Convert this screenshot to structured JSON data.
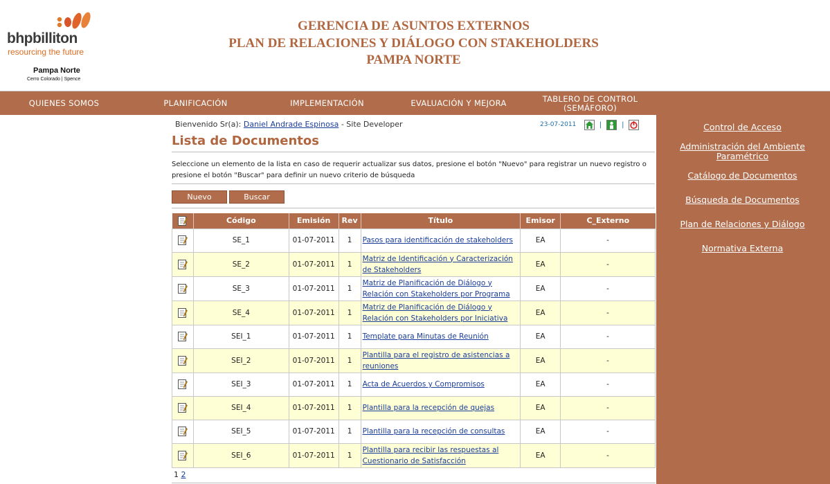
{
  "logo": {
    "brand": "bhpbilliton",
    "tagline": "resourcing the future",
    "site": "Pampa Norte",
    "sub": "Cerro Colorado | Spence"
  },
  "header": {
    "line1": "GERENCIA DE ASUNTOS EXTERNOS",
    "line2": "PLAN DE RELACIONES Y DIÁLOGO CON STAKEHOLDERS",
    "line3": "PAMPA NORTE"
  },
  "nav": {
    "items": [
      {
        "label": "QUIENES SOMOS"
      },
      {
        "label": "PLANIFICACIÓN"
      },
      {
        "label": "IMPLEMENTACIÓN"
      },
      {
        "label": "EVALUACIÓN Y MEJORA"
      },
      {
        "label": "TABLERO DE CONTROL (SEMÁFORO)"
      }
    ]
  },
  "sidebar": {
    "links": [
      {
        "label": "Control de Acceso"
      },
      {
        "label": "Administración del Ambiente Paramétrico"
      },
      {
        "label": "Catálogo de Documentos"
      },
      {
        "label": "Búsqueda de Documentos"
      },
      {
        "label": "Plan de Relaciones y Diálogo"
      },
      {
        "label": "Normativa Externa"
      }
    ]
  },
  "welcome": {
    "prefix": "Bienvenido Sr(a):",
    "user": "Daniel Andrade Espinosa",
    "role": "- Site Developer"
  },
  "toolbar": {
    "date": "23-07-2011",
    "sep": "|",
    "icons": [
      "home-icon",
      "user-icon",
      "power-icon"
    ]
  },
  "page": {
    "heading": "Lista de Documentos",
    "description": "Seleccione un elemento de la lista en caso de requerir actualizar sus datos, presione el botón \"Nuevo\" para registrar un nuevo registro o presione el botón \"Buscar\" para definir un nuevo criterio de búsqueda",
    "new_button": "Nuevo",
    "search_button": "Buscar"
  },
  "table": {
    "columns": [
      "Código",
      "Emisión",
      "Rev",
      "Título",
      "Emisor",
      "C_Externo"
    ],
    "rows": [
      {
        "codigo": "SE_1",
        "emision": "01-07-2011",
        "rev": "1",
        "titulo": "Pasos para identificación de stakeholders",
        "emisor": "EA",
        "externo": "-"
      },
      {
        "codigo": "SE_2",
        "emision": "01-07-2011",
        "rev": "1",
        "titulo": "Matriz de Identificación y Caracterización de Stakeholders",
        "emisor": "EA",
        "externo": "-"
      },
      {
        "codigo": "SE_3",
        "emision": "01-07-2011",
        "rev": "1",
        "titulo": "Matriz de Planificación de Diálogo y Relación con Stakeholders por Programa",
        "emisor": "EA",
        "externo": "-"
      },
      {
        "codigo": "SE_4",
        "emision": "01-07-2011",
        "rev": "1",
        "titulo": "Matriz de Planificación de Diálogo y Relación con Stakeholders por Iniciativa",
        "emisor": "EA",
        "externo": "-"
      },
      {
        "codigo": "SEI_1",
        "emision": "01-07-2011",
        "rev": "1",
        "titulo": "Template para Minutas de Reunión",
        "emisor": "EA",
        "externo": "-"
      },
      {
        "codigo": "SEI_2",
        "emision": "01-07-2011",
        "rev": "1",
        "titulo": "Plantilla para el registro de asistencias a reuniones",
        "emisor": "EA",
        "externo": "-"
      },
      {
        "codigo": "SEI_3",
        "emision": "01-07-2011",
        "rev": "1",
        "titulo": "Acta de Acuerdos y Compromisos",
        "emisor": "EA",
        "externo": "-"
      },
      {
        "codigo": "SEI_4",
        "emision": "01-07-2011",
        "rev": "1",
        "titulo": "Plantilla para la recepción de quejas",
        "emisor": "EA",
        "externo": "-"
      },
      {
        "codigo": "SEI_5",
        "emision": "01-07-2011",
        "rev": "1",
        "titulo": "Plantilla para la recepción de consultas",
        "emisor": "EA",
        "externo": "-"
      },
      {
        "codigo": "SEI_6",
        "emision": "01-07-2011",
        "rev": "1",
        "titulo": "Plantilla para recibir las respuestas al Cuestionario de Satisfacción",
        "emisor": "EA",
        "externo": "-"
      }
    ]
  },
  "pager": {
    "current": "1",
    "other": "2"
  },
  "colors": {
    "brand_brown": "#b06c4b",
    "title_brown": "#b0663f",
    "row_highlight": "#ffffd6",
    "link_blue": "#1a3d99",
    "logo_orange": "#d96b1f"
  }
}
